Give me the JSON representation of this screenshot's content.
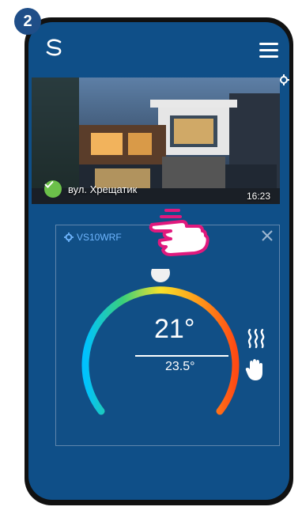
{
  "step": {
    "number": "2"
  },
  "app": {
    "logo_icon": "s-logo-icon",
    "menu_icon": "hamburger-menu-icon"
  },
  "location": {
    "name": "вул. Хрещатик",
    "time": "16:23",
    "status_icon": "checkmark-icon",
    "settings_icon": "gear-icon"
  },
  "thermostat": {
    "device_name": "VS10WRF",
    "current_temp": "21°",
    "set_temp": "23.5°",
    "mode_icons": [
      "heating-icon",
      "manual-hand-icon"
    ],
    "close_icon": "close-icon",
    "colors": {
      "accent": "#6fb6ff",
      "background": "#0f4f88",
      "knob": "#f0f0f0"
    }
  },
  "gesture": {
    "icon": "tap-hand-icon",
    "color": "#e0197d"
  }
}
